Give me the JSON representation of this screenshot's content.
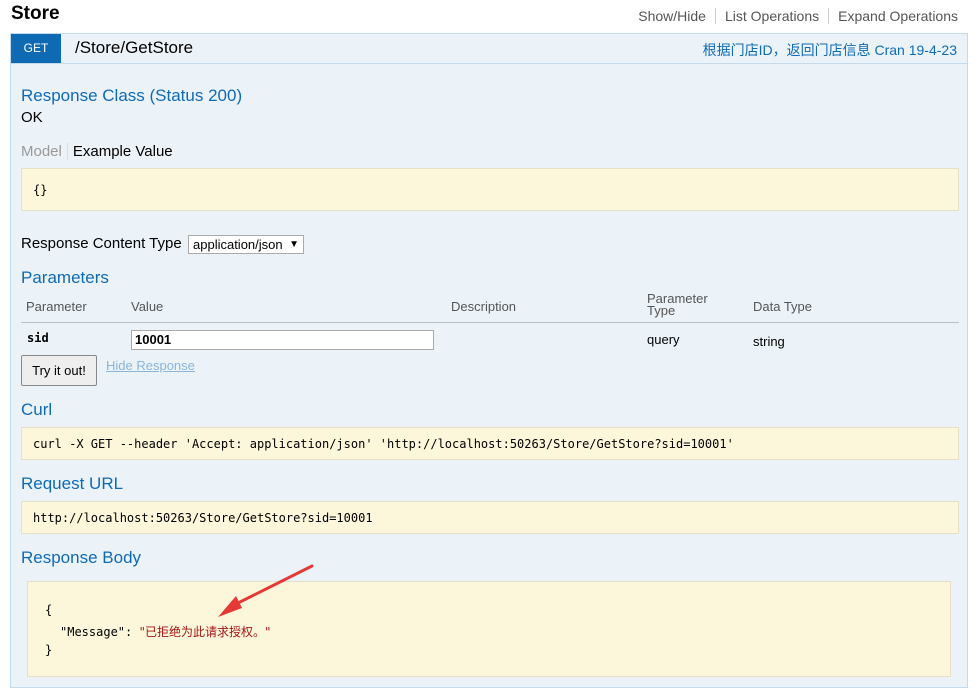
{
  "section": {
    "title": "Store",
    "links": [
      "Show/Hide",
      "List Operations",
      "Expand Operations"
    ]
  },
  "operation": {
    "method": "GET",
    "path": "/Store/GetStore",
    "summary": "根据门店ID，返回门店信息 Cran 19-4-23",
    "method_color": "#0f6ab4"
  },
  "response_class": {
    "heading": "Response Class (Status 200)",
    "value": "OK",
    "tab_model": "Model",
    "tab_example": "Example Value",
    "example": "{}"
  },
  "content_type": {
    "label": "Response Content Type",
    "selected": "application/json"
  },
  "parameters": {
    "heading": "Parameters",
    "columns": [
      "Parameter",
      "Value",
      "Description",
      "Parameter Type",
      "Data Type"
    ],
    "rows": [
      {
        "name": "sid",
        "value": "10001",
        "description": "",
        "param_type": "query",
        "data_type": "string"
      }
    ]
  },
  "actions": {
    "try_label": "Try it out!",
    "hide_label": "Hide Response"
  },
  "curl": {
    "heading": "Curl",
    "command": "curl -X GET --header 'Accept: application/json' 'http://localhost:50263/Store/GetStore?sid=10001'"
  },
  "request_url": {
    "heading": "Request URL",
    "url": "http://localhost:50263/Store/GetStore?sid=10001"
  },
  "response_body": {
    "heading": "Response Body",
    "open_brace": "{",
    "key": "\"Message\"",
    "colon": ": ",
    "value": "\"已拒绝为此请求授权。\"",
    "close_brace": "}"
  },
  "annotation_arrow_color": "#e53935"
}
